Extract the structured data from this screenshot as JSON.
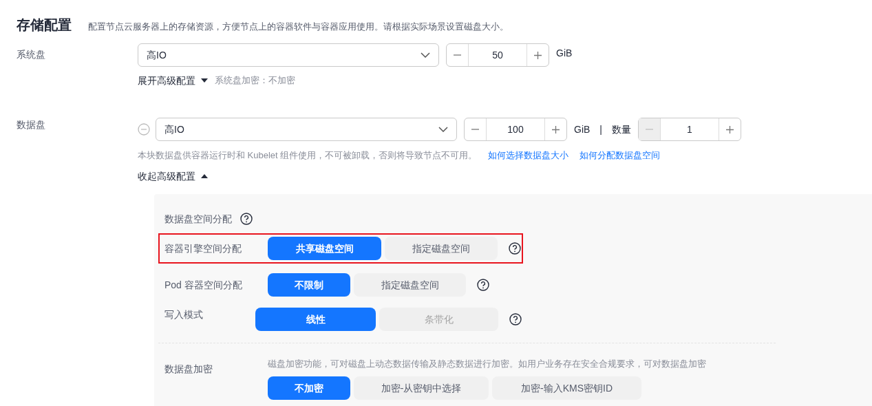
{
  "section": {
    "title": "存储配置",
    "description": "配置节点云服务器上的存储资源，方便节点上的容器软件与容器应用使用。请根据实际场景设置磁盘大小。"
  },
  "system_disk": {
    "label": "系统盘",
    "type": "高IO",
    "size": "50",
    "unit": "GiB",
    "advanced_toggle": {
      "label": "展开高级配置",
      "expanded": false
    },
    "encryption_note": "系统盘加密：不加密"
  },
  "data_disk": {
    "label": "数据盘",
    "type": "高IO",
    "size": "100",
    "unit": "GiB",
    "separator": "|",
    "count_label": "数量",
    "count": "1",
    "count_decrement_disabled": true,
    "note": "本块数据盘供容器运行时和 Kubelet 组件使用，不可被卸载，否则将导致节点不可用。",
    "links": [
      "如何选择数据盘大小",
      "如何分配数据盘空间"
    ],
    "advanced_toggle": {
      "label": "收起高级配置",
      "expanded": true
    }
  },
  "advanced": {
    "space_label": "数据盘空间分配",
    "rows": [
      {
        "label": "容器引擎空间分配",
        "highlighted": true,
        "options": [
          {
            "label": "共享磁盘空间",
            "selected": true,
            "disabled": false
          },
          {
            "label": "指定磁盘空间",
            "selected": false,
            "disabled": false
          }
        ]
      },
      {
        "label": "Pod 容器空间分配",
        "highlighted": false,
        "options": [
          {
            "label": "不限制",
            "selected": true,
            "disabled": false
          },
          {
            "label": "指定磁盘空间",
            "selected": false,
            "disabled": false
          }
        ]
      },
      {
        "label": "写入模式",
        "highlighted": false,
        "options": [
          {
            "label": "线性",
            "selected": true,
            "disabled": false
          },
          {
            "label": "条带化",
            "selected": false,
            "disabled": true
          }
        ]
      }
    ],
    "encryption": {
      "label": "数据盘加密",
      "description": "磁盘加密功能，可对磁盘上动态数据传输及静态数据进行加密。如用户业务存在安全合规要求，可对数据盘加密",
      "options": [
        {
          "label": "不加密",
          "selected": true,
          "disabled": false
        },
        {
          "label": "加密-从密钥中选择",
          "selected": false,
          "disabled": false
        },
        {
          "label": "加密-输入KMS密钥ID",
          "selected": false,
          "disabled": false
        }
      ]
    }
  }
}
